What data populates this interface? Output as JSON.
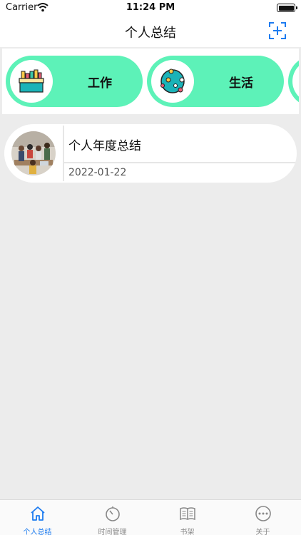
{
  "status_bar": {
    "carrier": "Carrier",
    "time": "11:24 PM"
  },
  "header": {
    "title": "个人总结",
    "add_icon": "add-square-icon"
  },
  "categories": [
    {
      "label": "工作",
      "icon": "briefcase-icon"
    },
    {
      "label": "生活",
      "icon": "planet-icon"
    }
  ],
  "summaries": [
    {
      "title": "个人年度总结",
      "date": "2022-01-22",
      "thumbnail": "team-photo"
    }
  ],
  "tab_bar": {
    "tabs": [
      {
        "label": "个人总结",
        "icon": "home-icon",
        "active": true
      },
      {
        "label": "时间管理",
        "icon": "timer-icon",
        "active": false
      },
      {
        "label": "书架",
        "icon": "book-icon",
        "active": false
      },
      {
        "label": "关于",
        "icon": "more-circle-icon",
        "active": false
      }
    ]
  },
  "colors": {
    "accent": "#1e7cf0",
    "card": "#5df2b8",
    "background": "#ececec"
  }
}
